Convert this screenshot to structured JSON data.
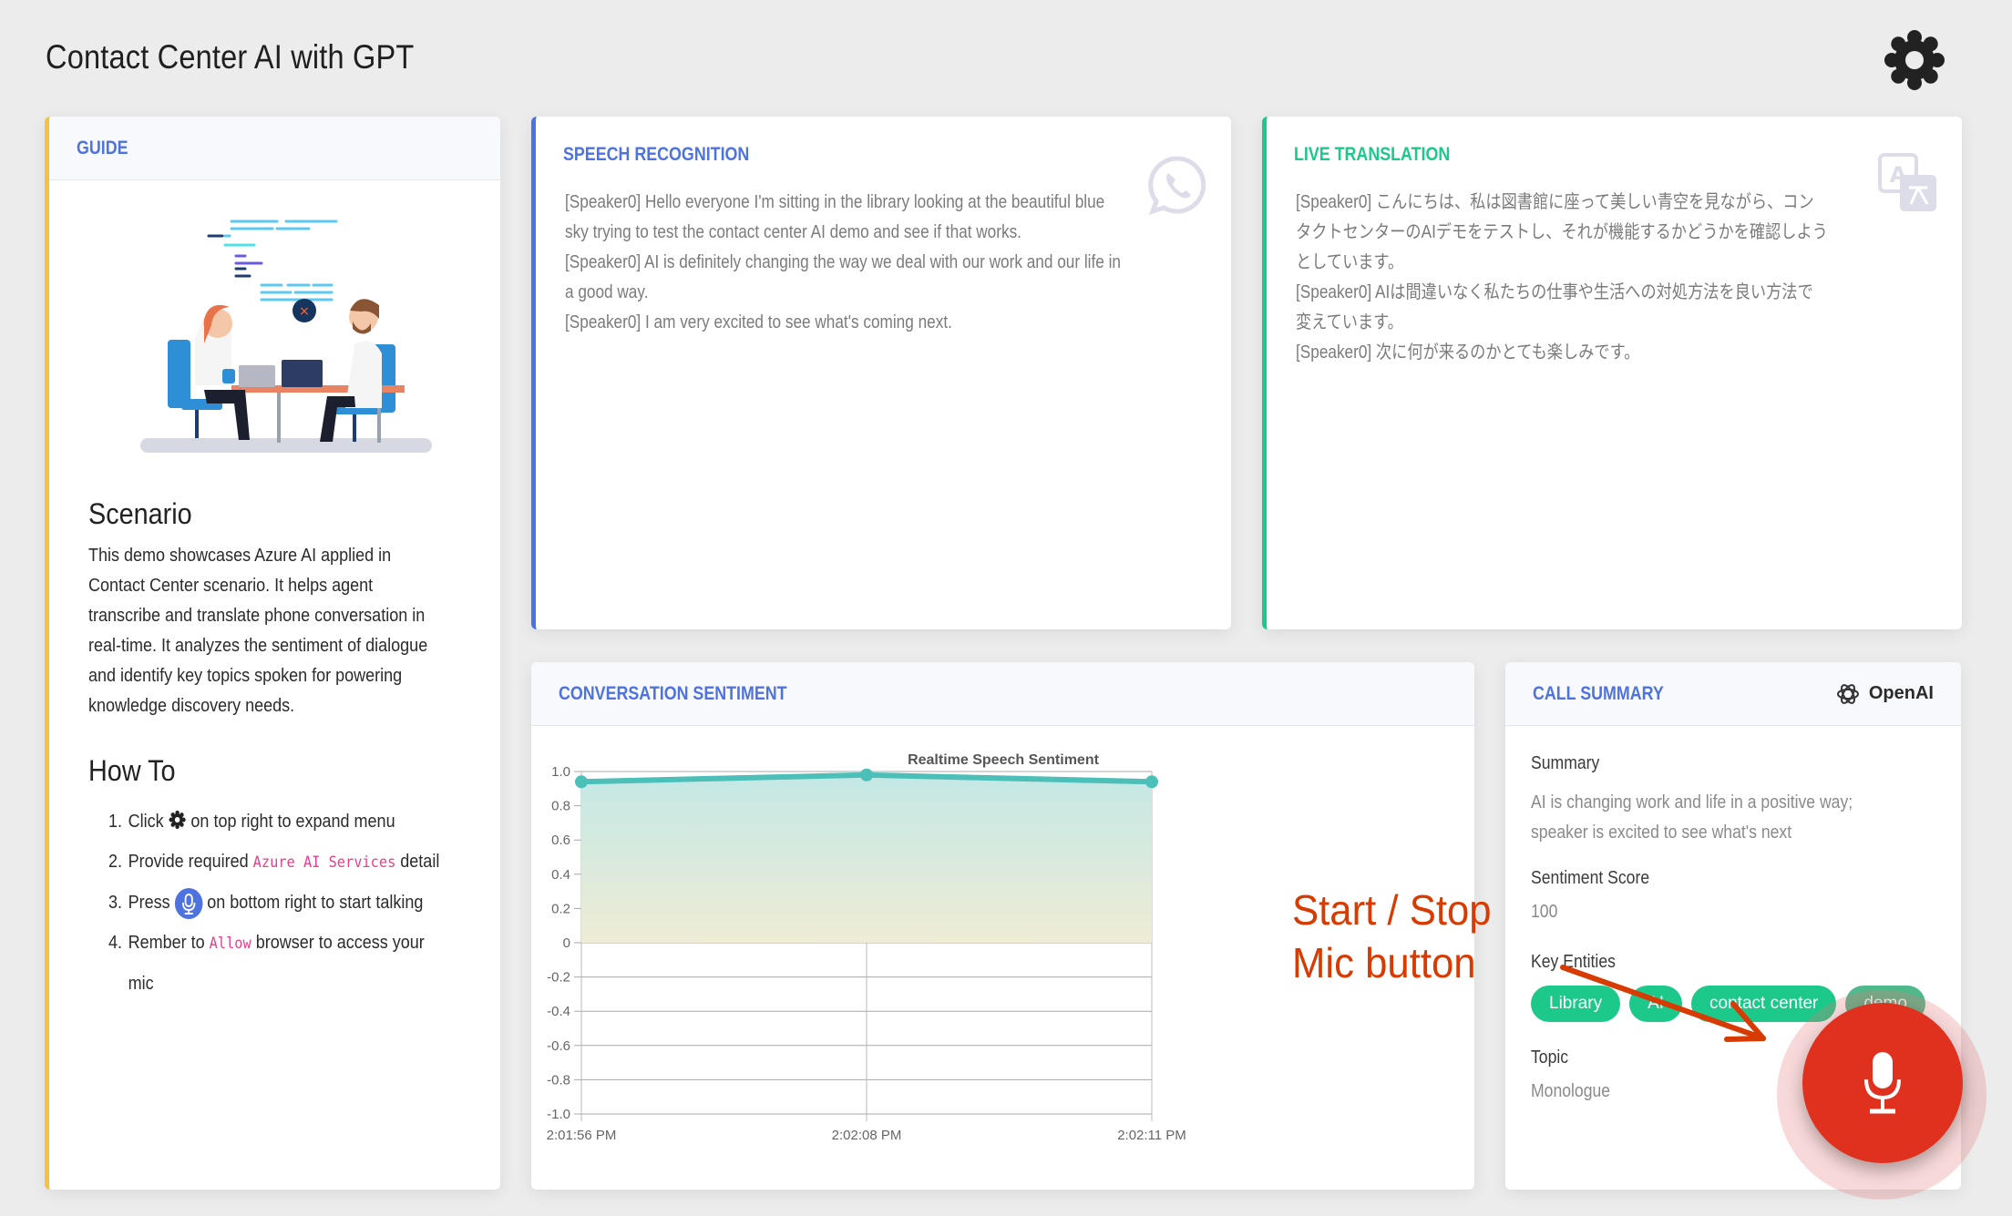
{
  "header": {
    "title": "Contact Center AI with GPT",
    "settings_icon": "gear-icon"
  },
  "guide": {
    "title": "GUIDE",
    "illustration": "two-people-working-at-desk-illustration",
    "scenario_heading": "Scenario",
    "scenario_text": "This demo showcases Azure AI applied in Contact Center scenario. It helps agent transcribe and translate phone conversation in real-time. It analyzes the sentiment of dialogue and identify key topics spoken for powering knowledge discovery needs.",
    "howto_heading": "How To",
    "steps": [
      {
        "num": "1.",
        "before": "Click",
        "icon": "gear-icon",
        "after": "on top right to expand menu"
      },
      {
        "num": "2.",
        "before": "Provide required",
        "code": "Azure AI Services",
        "after": "detail"
      },
      {
        "num": "3.",
        "before": "Press",
        "icon": "mic-icon",
        "after": "on bottom right to start talking"
      },
      {
        "num": "4.",
        "before": "Rember to",
        "code": "Allow",
        "after": "browser to access your mic"
      }
    ]
  },
  "speech": {
    "title": "SPEECH RECOGNITION",
    "icon": "whatsapp-phone-icon",
    "lines": [
      "[Speaker0] Hello everyone I'm sitting in the library looking at the beautiful blue sky trying to test the contact center AI demo and see if that works.",
      "[Speaker0] AI is definitely changing the way we deal with our work and our life in a good way.",
      "[Speaker0] I am very excited to see what's coming next."
    ]
  },
  "translation": {
    "title": "LIVE TRANSLATION",
    "icon": "translate-icon",
    "lines": [
      "[Speaker0] こんにちは、私は図書館に座って美しい青空を見ながら、コンタクトセンターのAIデモをテストし、それが機能するかどうかを確認しようとしています。",
      "[Speaker0] AIは間違いなく私たちの仕事や生活への対処方法を良い方法で変えています。",
      "[Speaker0] 次に何が来るのかとても楽しみです。"
    ]
  },
  "sentiment": {
    "title": "CONVERSATION SENTIMENT"
  },
  "chart_data": {
    "type": "area",
    "title": "Realtime Speech Sentiment",
    "xlabel": "",
    "ylabel": "",
    "categories": [
      "2:01:56 PM",
      "2:02:08 PM",
      "2:02:11 PM"
    ],
    "series": [
      {
        "name": "Sentiment",
        "values": [
          0.94,
          0.98,
          0.94
        ],
        "color": "#4bbfb8"
      }
    ],
    "ylim": [
      -1.0,
      1.0
    ],
    "yticks": [
      "1.0",
      "0.8",
      "0.6",
      "0.4",
      "0.2",
      "0",
      "-0.2",
      "-0.4",
      "-0.6",
      "-0.8",
      "-1.0"
    ],
    "grid": true,
    "legend": "none"
  },
  "summary": {
    "title": "CALL SUMMARY",
    "brand": "OpenAI",
    "summary_label": "Summary",
    "summary_text": "AI is changing work and life in a positive way; speaker is excited to see what's next",
    "score_label": "Sentiment Score",
    "score_value": "100",
    "entities_label": "Key Entities",
    "entities": [
      "Library",
      "AI",
      "contact center",
      "demo"
    ],
    "topic_label": "Topic",
    "topic_value": "Monologue"
  },
  "mic": {
    "icon": "mic-icon",
    "state_color": "#e0301e"
  },
  "annotation": {
    "line1": "Start / Stop",
    "line2": "Mic button"
  },
  "colors": {
    "primary": "#4e73df",
    "success": "#1cc88a",
    "warning": "#f6c23e",
    "danger": "#e0301e",
    "annotation": "#d83b01"
  }
}
